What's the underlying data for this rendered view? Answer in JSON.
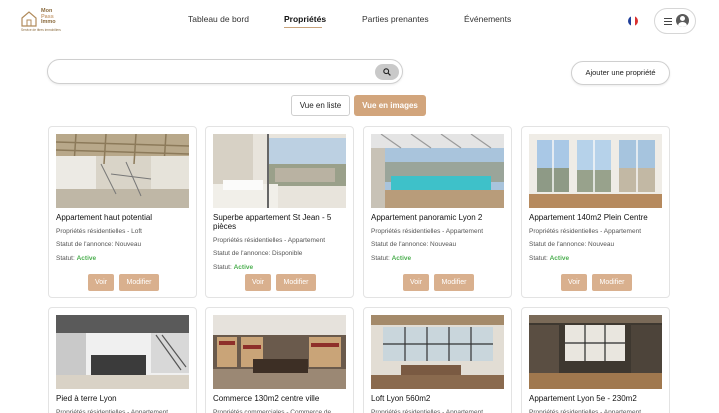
{
  "brand": {
    "logo_line1": "Mon",
    "logo_line2": "Pass",
    "logo_line3": "Immo",
    "tagline": "Service de titres immobiliers",
    "accent_color": "#d2a57c"
  },
  "nav": {
    "items": [
      {
        "label": "Tableau de bord",
        "active": false
      },
      {
        "label": "Propriétés",
        "active": true
      },
      {
        "label": "Parties prenantes",
        "active": false
      },
      {
        "label": "Événements",
        "active": false
      }
    ],
    "language_icon": "french-flag-icon",
    "menu_icon": "hamburger-icon",
    "user_icon": "user-avatar-icon"
  },
  "search": {
    "placeholder": "",
    "value": "",
    "icon": "search-icon"
  },
  "actions": {
    "add_property": "Ajouter une propriété"
  },
  "view_toggle": {
    "list": "Vue en liste",
    "images": "Vue en images",
    "selected": "images"
  },
  "properties": [
    {
      "title": "Appartement haut potential",
      "type": "Propriétés résidentielles - Loft",
      "annonce": "Statut de l'annonce: Nouveau",
      "statut_label": "Statut:",
      "statut_value": "Active",
      "voir": "Voir",
      "modifier": "Modifier"
    },
    {
      "title": "Superbe appartement St Jean - 5 pièces",
      "type": "Propriétés résidentielles - Appartement",
      "annonce": "Statut de l'annonce: Disponible",
      "statut_label": "Statut:",
      "statut_value": "Active",
      "voir": "Voir",
      "modifier": "Modifier"
    },
    {
      "title": "Appartement panoramic Lyon 2",
      "type": "Propriétés résidentielles - Appartement",
      "annonce": "Statut de l'annonce: Nouveau",
      "statut_label": "Statut:",
      "statut_value": "Active",
      "voir": "Voir",
      "modifier": "Modifier"
    },
    {
      "title": "Appartement 140m2 Plein Centre",
      "type": "Propriétés résidentielles - Appartement",
      "annonce": "Statut de l'annonce: Nouveau",
      "statut_label": "Statut:",
      "statut_value": "Active",
      "voir": "Voir",
      "modifier": "Modifier"
    },
    {
      "title": "Pied à terre Lyon",
      "type": "Propriétés résidentielles - Appartement"
    },
    {
      "title": "Commerce 130m2 centre ville",
      "type": "Propriétés commerciales - Commerce de"
    },
    {
      "title": "Loft Lyon 560m2",
      "type": "Propriétés résidentielles - Appartement"
    },
    {
      "title": "Appartement Lyon 5e - 230m2",
      "type": "Propriétés résidentielles - Appartement"
    }
  ]
}
